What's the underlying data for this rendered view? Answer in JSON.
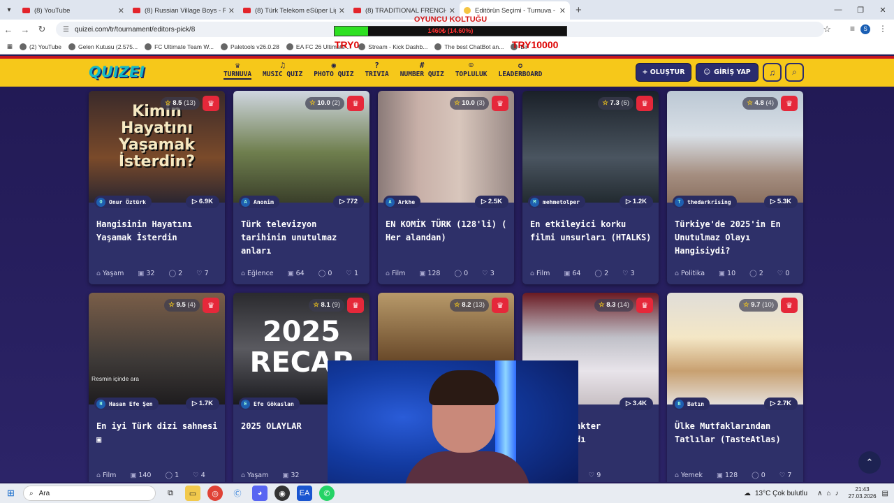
{
  "browser": {
    "tabs": [
      {
        "label": "(8) YouTube",
        "active": false
      },
      {
        "label": "(8) Russian Village Boys - R",
        "active": false
      },
      {
        "label": "(8) Türk Telekom eSüper Lig | 3",
        "active": false
      },
      {
        "label": "(8) TRADITIONAL FRENCH BIO",
        "active": false
      },
      {
        "label": "Editörün Seçimi - Turnuva - Qu",
        "active": true
      }
    ],
    "url": "quizei.com/tr/tournament/editors-pick/8",
    "profile_initial": "S",
    "bookmarks": [
      "(2) YouTube",
      "Gelen Kutusu (2.575...",
      "FC Ultimate Team W...",
      "Paletools v26.0.28",
      "EA FC 26 Ultimate ...",
      "Stream - Kick Dashb...",
      "The best ChatBot an...",
      "Bir"
    ]
  },
  "overlay": {
    "title": "OYUNCU KOLTUĞU",
    "bar_text": "1460₺ (14.60%)",
    "progress": 0.146,
    "left_amount": "TRY0",
    "right_amount": "TRY10000"
  },
  "site": {
    "logo": "QUIZEI",
    "nav": [
      {
        "label": "TURNUVA",
        "icon": "trophy-icon",
        "glyph": "♛"
      },
      {
        "label": "MUSIC QUIZ",
        "icon": "music-icon",
        "glyph": "♫"
      },
      {
        "label": "PHOTO QUIZ",
        "icon": "camera-icon",
        "glyph": "◉"
      },
      {
        "label": "TRIVIA",
        "icon": "question-icon",
        "glyph": "?"
      },
      {
        "label": "NUMBER QUIZ",
        "icon": "hash-icon",
        "glyph": "#"
      },
      {
        "label": "TOPLULUK",
        "icon": "users-icon",
        "glyph": "☺"
      },
      {
        "label": "LEADERBOARD",
        "icon": "medal-icon",
        "glyph": "✪"
      }
    ],
    "create_label": "+ OLUŞTUR",
    "login_label": "GİRİŞ YAP"
  },
  "cards": [
    {
      "rating": "8.5",
      "votes": "(13)",
      "author": "Onur Öztürk",
      "author_initial": "O",
      "plays": "6.9K",
      "title": "Hangisinin Hayatını Yaşamak İsterdin",
      "category": "Yaşam",
      "items": "32",
      "comments": "2",
      "likes": "7",
      "thumb_text": "Kimin Hayatını Yaşamak İsterdin?",
      "thumb_bg": "linear-gradient(180deg,#3a2a2a,#7a4a2a 60%,#2b2630)"
    },
    {
      "rating": "10.0",
      "votes": "(2)",
      "author": "Anonim",
      "author_initial": "A",
      "plays": "772",
      "title": "Türk televizyon tarihinin unutulmaz anları",
      "category": "Eğlence",
      "items": "64",
      "comments": "0",
      "likes": "1",
      "thumb_text": "",
      "thumb_bg": "linear-gradient(180deg,#cfd6e0,#6f7f4e 55%,#3a3f2a)"
    },
    {
      "rating": "10.0",
      "votes": "(3)",
      "author": "Arkhe",
      "author_initial": "A",
      "plays": "2.5K",
      "title": "EN KOMİK TÜRK (128'li) ( Her alandan)",
      "category": "Film",
      "items": "128",
      "comments": "0",
      "likes": "3",
      "thumb_text": "",
      "thumb_bg": "linear-gradient(90deg,#8a7a78,#c8b0a8 30%,#d8c6bc 60%,#9a8a86)"
    },
    {
      "rating": "7.3",
      "votes": "(6)",
      "author": "mehmetolper",
      "author_initial": "M",
      "plays": "1.2K",
      "title": "En etkileyici korku filmi unsurları (HTALKS)",
      "category": "Film",
      "items": "64",
      "comments": "2",
      "likes": "3",
      "thumb_text": "",
      "thumb_bg": "linear-gradient(180deg,#1a2028,#4a5560 60%,#222a30)"
    },
    {
      "rating": "4.8",
      "votes": "(4)",
      "author": "thedarkrising",
      "author_initial": "T",
      "plays": "5.3K",
      "title": "Türkiye'de 2025'in En Unutulmaz Olayı Hangisiydi?",
      "category": "Politika",
      "items": "10",
      "comments": "2",
      "likes": "0",
      "thumb_text": "",
      "thumb_bg": "linear-gradient(180deg,#bcc8d4,#d8dfe6 40%,#a58e80 75%,#8a7060)"
    },
    {
      "rating": "9.5",
      "votes": "(4)",
      "author": "Hasan Efe Şen",
      "author_initial": "H",
      "plays": "1.7K",
      "title": "En iyi Türk dizi sahnesi ▣",
      "category": "Film",
      "items": "140",
      "comments": "1",
      "likes": "4",
      "thumb_text": "",
      "thumb_bg": "linear-gradient(180deg,#7a5e48,#3e3a38 60%,#1e1c1e)"
    },
    {
      "rating": "8.1",
      "votes": "(9)",
      "author": "Efe Gökaslan",
      "author_initial": "E",
      "plays": "",
      "title": "2025 OLAYLAR",
      "category": "Yaşam",
      "items": "32",
      "comments": "",
      "likes": "",
      "thumb_text": "2025 RECAP",
      "thumb_bg": "linear-gradient(180deg,#2a2a2e,#5a5a60 50%,#1a1a1e)"
    },
    {
      "rating": "8.2",
      "votes": "(13)",
      "author": "",
      "author_initial": "",
      "plays": "",
      "title": "",
      "category": "",
      "items": "",
      "comments": "",
      "likes": "",
      "thumb_text": "",
      "thumb_bg": "linear-gradient(180deg,#b89a6a,#6a4a2a 60%,#3a2818)"
    },
    {
      "rating": "8.3",
      "votes": "(14)",
      "author": "...utt",
      "author_initial": "",
      "plays": "3.4K",
      "title": "...tü karakter ...naklıydı",
      "category": "",
      "items": "29",
      "comments": "0",
      "likes": "9",
      "thumb_text": "",
      "thumb_bg": "linear-gradient(180deg,#6a1a22,#c0c0c8 40%,#e8e4ea 70%,#c8c0c4)"
    },
    {
      "rating": "9.7",
      "votes": "(10)",
      "author": "Batın",
      "author_initial": "B",
      "plays": "2.7K",
      "title": "Ülke Mutfaklarından Tatlılar (TasteAtlas)",
      "category": "Yemek",
      "items": "128",
      "comments": "0",
      "likes": "7",
      "thumb_text": "",
      "thumb_bg": "linear-gradient(180deg,#e0ddd8,#f4e7c6 40%,#c8a070 70%,#e4dfda)"
    }
  ],
  "image_search_hint": "Resmin içinde ara",
  "taskbar": {
    "search_placeholder": "Ara",
    "weather": "13°C  Çok bulutlu",
    "time": "21:43",
    "date": "27.03.2026"
  }
}
